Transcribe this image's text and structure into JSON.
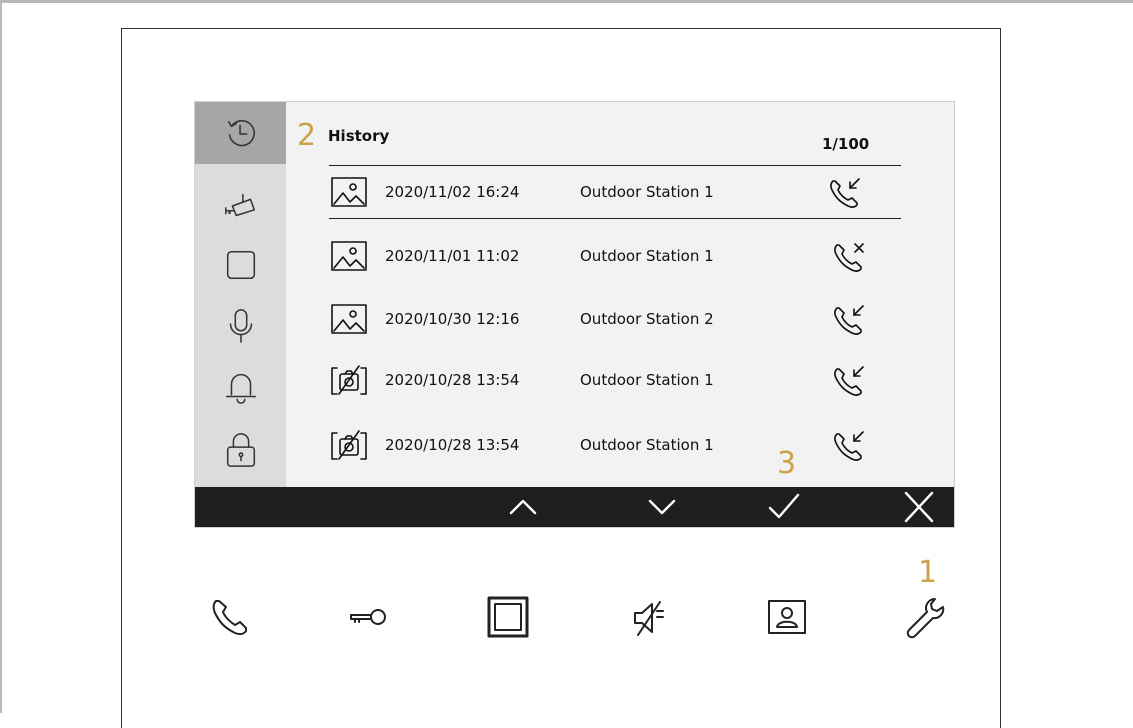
{
  "callouts": {
    "one": "1",
    "two": "2",
    "three": "3"
  },
  "history": {
    "title": "History",
    "count": "1/100",
    "rows": [
      {
        "thumbnail": "image-icon",
        "date": "2020/11/02 16:24",
        "station": "Outdoor Station 1",
        "call_type": "incoming-call-icon"
      },
      {
        "thumbnail": "image-icon",
        "date": "2020/11/01 11:02",
        "station": "Outdoor Station 1",
        "call_type": "missed-call-icon"
      },
      {
        "thumbnail": "image-icon",
        "date": "2020/10/30 12:16",
        "station": "Outdoor Station 2",
        "call_type": "incoming-call-icon"
      },
      {
        "thumbnail": "no-image-icon",
        "date": "2020/10/28 13:54",
        "station": "Outdoor Station 1",
        "call_type": "incoming-call-icon"
      },
      {
        "thumbnail": "no-image-icon",
        "date": "2020/10/28 13:54",
        "station": "Outdoor Station 1",
        "call_type": "incoming-call-icon"
      }
    ]
  },
  "sidebar": {
    "items": [
      {
        "icon": "history-icon",
        "active": true
      },
      {
        "icon": "surveillance-camera-icon",
        "active": false
      },
      {
        "icon": "square-icon",
        "active": false
      },
      {
        "icon": "microphone-icon",
        "active": false
      },
      {
        "icon": "bell-icon",
        "active": false
      },
      {
        "icon": "lock-icon",
        "active": false
      }
    ]
  },
  "bottom_bar": {
    "buttons": [
      "chevron-up-icon",
      "chevron-down-icon",
      "checkmark-icon",
      "close-icon"
    ],
    "background": "#1f1f1f"
  },
  "hardware_buttons": [
    "phone-icon",
    "key-icon",
    "square-frame-icon",
    "mute-icon",
    "intercom-screen-icon",
    "wrench-icon"
  ],
  "colors": {
    "callout": "#c9a24a",
    "sidebar_bg": "#dcdcdc",
    "sidebar_active": "#a6a6a6",
    "screen_bg": "#f2f2f2"
  }
}
